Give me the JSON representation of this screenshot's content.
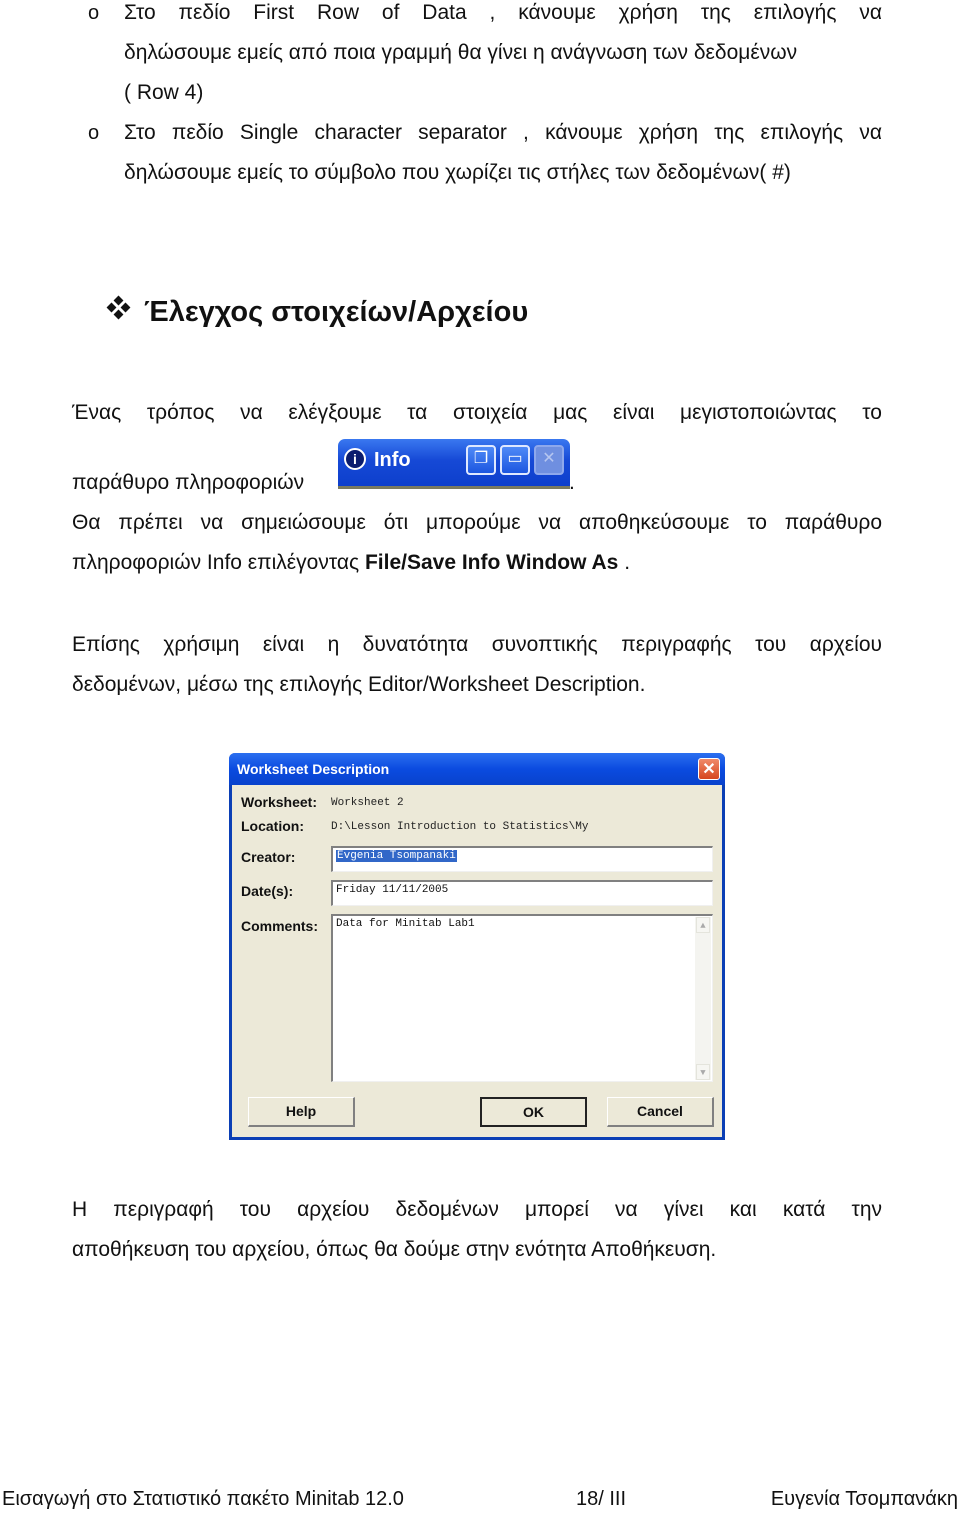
{
  "bullets": [
    {
      "marker": "o",
      "lines": [
        "Στο πεδίο First Row of Data , κάνουμε χρήση της επιλογής να",
        "δηλώσουμε εμείς από ποια γραμμή θα γίνει η ανάγνωση των δεδομένων",
        "( Row 4)"
      ]
    },
    {
      "marker": "o",
      "lines": [
        "Στο πεδίο Single character separator , κάνουμε χρήση της επιλογής να",
        "δηλώσουμε εμείς το σύμβολο που χωρίζει τις στήλες των δεδομένων( #)"
      ]
    }
  ],
  "section": {
    "icon": "diamond-bullet-icon",
    "title": "Έλεγχος στοιχείων/Αρχείου"
  },
  "para1": {
    "line1": "Ένας τρόπος να ελέγξουμε τα στοιχεία μας είναι μεγιστοποιώντας το",
    "line2_before": "παράθυρο πληροφοριών",
    "line2_after": ".",
    "line3": "Θα πρέπει να σημειώσουμε ότι μπορούμε να αποθηκεύσουμε το παράθυρο",
    "line4_before": "πληροφοριών Info επιλέγοντας ",
    "line4_bold": "File/Save Info Window As",
    "line4_after": " ."
  },
  "info_bar": {
    "title": "Info",
    "icon": "info-icon",
    "buttons": [
      "restore",
      "maximize",
      "close"
    ]
  },
  "para2": {
    "line1": "Επίσης χρήσιμη είναι η δυνατότητα συνοπτικής περιγραφής του αρχείου",
    "line2": "δεδομένων, μέσω της επιλογής Editor/Worksheet Description."
  },
  "dialog": {
    "title": "Worksheet Description",
    "close_glyph": "✕",
    "worksheet_label": "Worksheet:",
    "worksheet_value": "Worksheet 2",
    "location_label": "Location:",
    "location_value": "D:\\Lesson Introduction to Statistics\\My",
    "creator_label": "Creator:",
    "creator_value": "Evgenia Tsompanaki",
    "dates_label": "Date(s):",
    "dates_value": "Friday 11/11/2005",
    "comments_label": "Comments:",
    "comments_value": "Data for Minitab Lab1",
    "buttons": {
      "help": "Help",
      "ok": "OK",
      "cancel": "Cancel"
    }
  },
  "para3": {
    "line1": "Η περιγραφή του αρχείου δεδομένων μπορεί να γίνει και κατά την",
    "line2": "αποθήκευση του αρχείου, όπως θα δούμε στην ενότητα Αποθήκευση."
  },
  "footer": {
    "left": "Εισαγωγή στο Στατιστικό πακέτο Minitab 12.0",
    "center": "18/ III",
    "right": "Ευγενία Τσομπανάκη"
  }
}
